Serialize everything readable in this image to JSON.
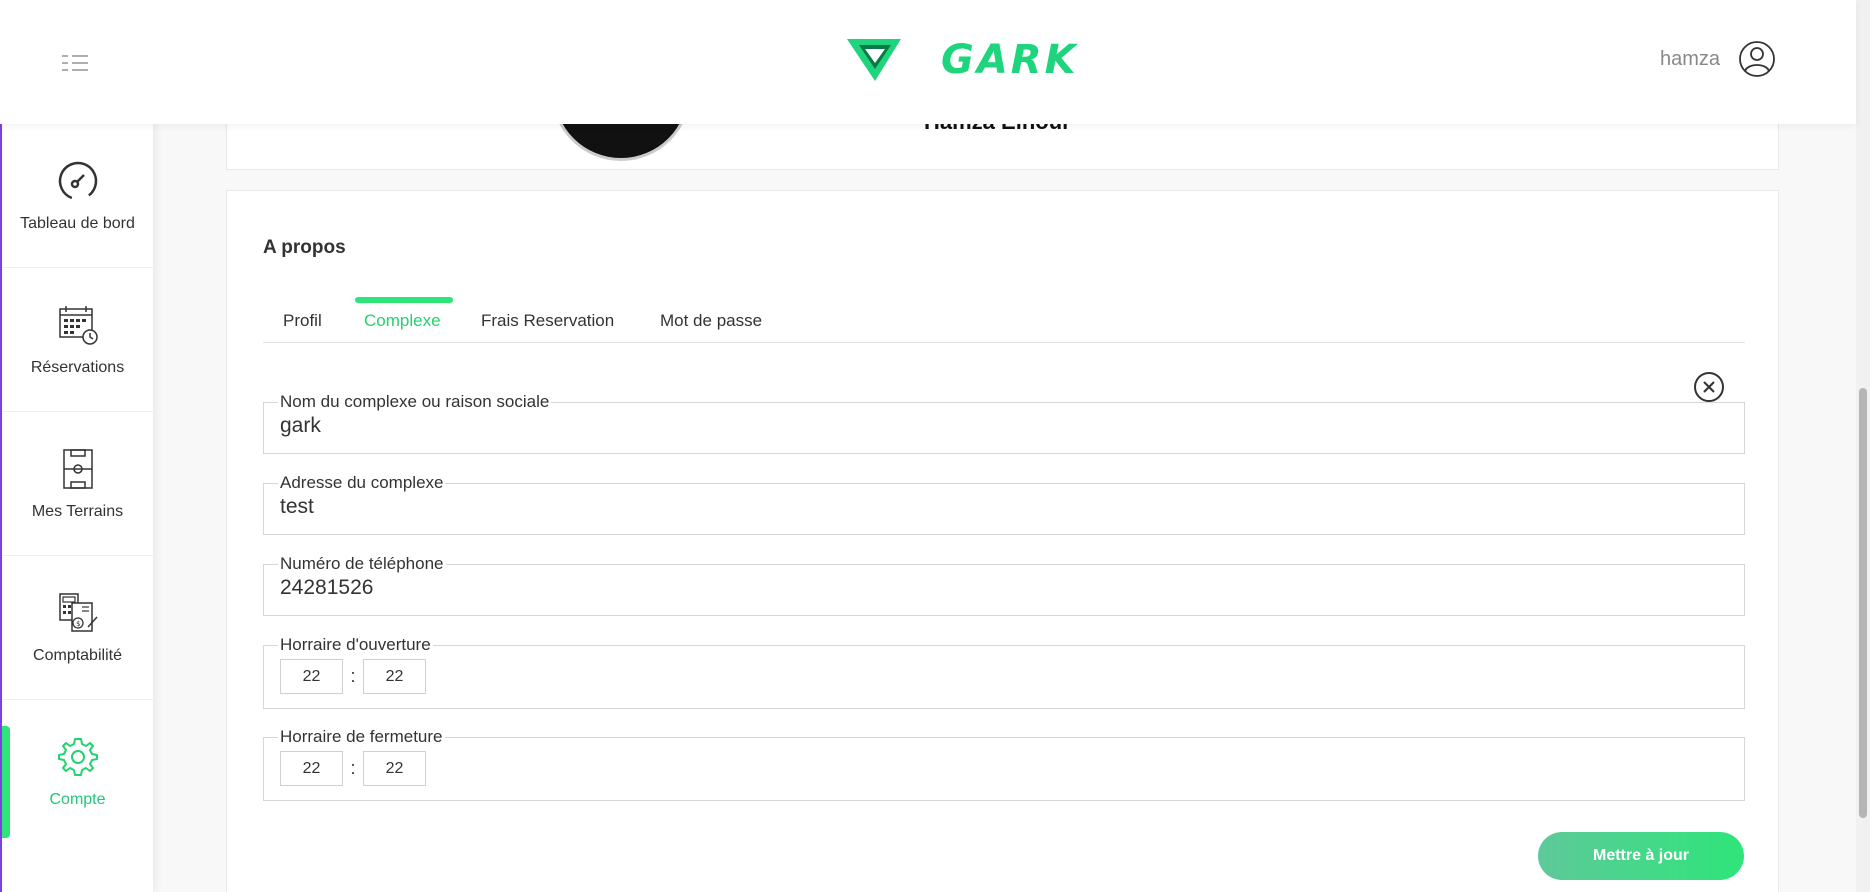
{
  "header": {
    "brand": "GARK",
    "user_name": "hamza",
    "icons": [
      "menu-icon",
      "logo-icon",
      "user-avatar-icon"
    ]
  },
  "sidebar": {
    "items": [
      {
        "label": "Tableau de bord",
        "icon": "dashboard-gauge-icon"
      },
      {
        "label": "Réservations",
        "icon": "calendar-clock-icon"
      },
      {
        "label": "Mes Terrains",
        "icon": "football-field-icon"
      },
      {
        "label": "Comptabilité",
        "icon": "accounting-icon"
      },
      {
        "label": "Compte",
        "icon": "gear-icon",
        "active": true
      }
    ]
  },
  "profile": {
    "name": "Hamza Elhour"
  },
  "about": {
    "title": "A propos",
    "tabs": [
      {
        "label": "Profil"
      },
      {
        "label": "Complexe",
        "active": true
      },
      {
        "label": "Frais Reservation"
      },
      {
        "label": "Mot de passe"
      }
    ],
    "fields": {
      "name": {
        "label": "Nom du complexe ou raison sociale",
        "value": "gark"
      },
      "address": {
        "label": "Adresse du complexe",
        "value": "test"
      },
      "phone": {
        "label": "Numéro de téléphone",
        "value": "24281526"
      },
      "opening": {
        "label": "Horraire d'ouverture",
        "hours": "22",
        "minutes": "22"
      },
      "closing": {
        "label": "Horraire de fermeture",
        "hours": "22",
        "minutes": "22"
      }
    },
    "separator": ":",
    "submit_label": "Mettre à jour"
  },
  "colors": {
    "accent": "#2ee57a",
    "accent_text": "#22c77a",
    "sidebar_border": "#7b3fe4"
  }
}
